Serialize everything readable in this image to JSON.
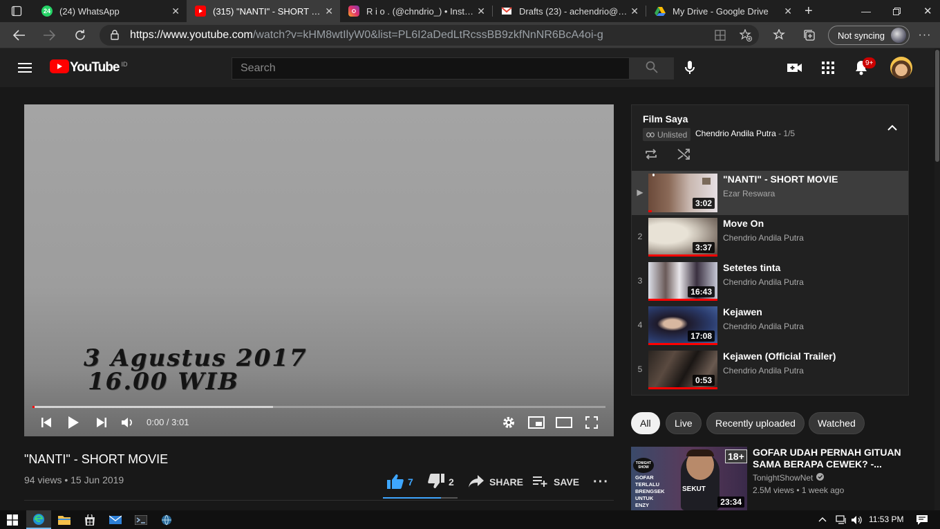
{
  "browser": {
    "tabs": [
      {
        "title": "(24) WhatsApp",
        "favicon": "whatsapp-icon",
        "badge": "24"
      },
      {
        "title": "(315) \"NANTI\" - SHORT MOVIE",
        "favicon": "youtube-icon"
      },
      {
        "title": "R i o . (@chndrio_) • Instagram",
        "favicon": "instagram-icon"
      },
      {
        "title": "Drafts (23) - achendrio@gmail.com",
        "favicon": "gmail-icon"
      },
      {
        "title": "My Drive - Google Drive",
        "favicon": "google-drive-icon"
      }
    ],
    "url_host": "https://www.youtube.com",
    "url_path": "/watch?v=kHM8wtIlyW0&list=PL6I2aDedLtRcssBB9zkfNnNR6BcA4oi-g",
    "sync_label": "Not syncing"
  },
  "header": {
    "logo_text": "YouTube",
    "region": "ID",
    "search_placeholder": "Search",
    "notification_count": "9+"
  },
  "player": {
    "overlay_line1": "3 Agustus 2017",
    "overlay_line2": "16.00 WIB",
    "time": "0:00 / 3:01",
    "played_fraction": 0.0,
    "buffered_fraction": 0.42
  },
  "video": {
    "title": "\"NANTI\" - SHORT MOVIE",
    "meta": "94 views • 15 Jun 2019",
    "likes": "7",
    "dislikes": "2",
    "share_label": "SHARE",
    "save_label": "SAVE",
    "like_ratio": 0.78
  },
  "playlist": {
    "title": "Film Saya",
    "badge": "Unlisted",
    "owner": "Chendrio Andila Putra",
    "position": " - 1/5",
    "items": [
      {
        "index": "▶",
        "title": "\"NANTI\" - SHORT MOVIE",
        "channel": "Ezar Reswara",
        "duration": "3:02",
        "watched": 0.05
      },
      {
        "index": "2",
        "title": "Move On",
        "channel": "Chendrio Andila Putra",
        "duration": "3:37",
        "watched": 1.0
      },
      {
        "index": "3",
        "title": "Setetes tinta",
        "channel": "Chendrio Andila Putra",
        "duration": "16:43",
        "watched": 1.0
      },
      {
        "index": "4",
        "title": "Kejawen",
        "channel": "Chendrio Andila Putra",
        "duration": "17:08",
        "watched": 1.0
      },
      {
        "index": "5",
        "title": "Kejawen (Official Trailer)",
        "channel": "Chendrio Andila Putra",
        "duration": "0:53",
        "watched": 1.0
      }
    ]
  },
  "chips": [
    "All",
    "Live",
    "Recently uploaded",
    "Watched"
  ],
  "recommendation": {
    "title": "GOFAR UDAH PERNAH GITUAN SAMA BERAPA CEWEK? -...",
    "channel": "TonightShowNet",
    "meta": "2.5M views • 1 week ago",
    "duration": "23:34",
    "rating_badge": "18+",
    "thumb_show": "TONIGHT SHOW",
    "thumb_caption": "GOFAR TERLALU BRENGSEK UNTUK ENZY",
    "thumb_shirt": "SEKUT"
  },
  "taskbar": {
    "time": "11:53 PM"
  },
  "colors": {
    "accent_red": "#ff0000",
    "link_blue": "#3ea6ff",
    "bg": "#181818"
  }
}
